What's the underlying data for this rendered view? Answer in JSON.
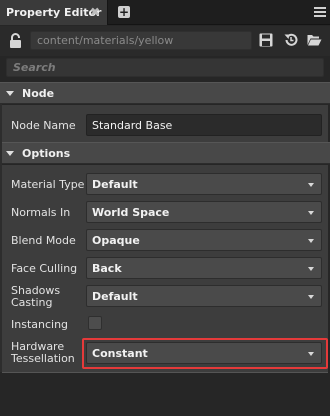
{
  "tab": {
    "title": "Property Editor",
    "close_icon": "✖",
    "add_icon": "+",
    "menu_icon": "hamburger-menu-icon"
  },
  "path": {
    "value": "content/materials/yellow",
    "icons": [
      "lock-icon",
      "save-icon",
      "revert-icon",
      "folder-open-icon"
    ]
  },
  "search": {
    "placeholder": "Search"
  },
  "sections": {
    "node": {
      "title": "Node"
    },
    "options": {
      "title": "Options"
    }
  },
  "node_name": {
    "label": "Node Name",
    "value": "Standard Base"
  },
  "options": {
    "material_type": {
      "label": "Material Type",
      "value": "Default"
    },
    "normals_in": {
      "label": "Normals In",
      "value": "World Space"
    },
    "blend_mode": {
      "label": "Blend Mode",
      "value": "Opaque"
    },
    "face_culling": {
      "label": "Face Culling",
      "value": "Back"
    },
    "shadows_casting": {
      "label_1": "Shadows",
      "label_2": "Casting",
      "value": "Default"
    },
    "instancing": {
      "label": "Instancing",
      "checked": false
    },
    "hardware_tessellation": {
      "label_1": "Hardware",
      "label_2": "Tessellation",
      "value": "Constant"
    }
  },
  "colors": {
    "highlight": "#e53a3a",
    "panel": "#3d3d3d",
    "header": "#484848"
  }
}
